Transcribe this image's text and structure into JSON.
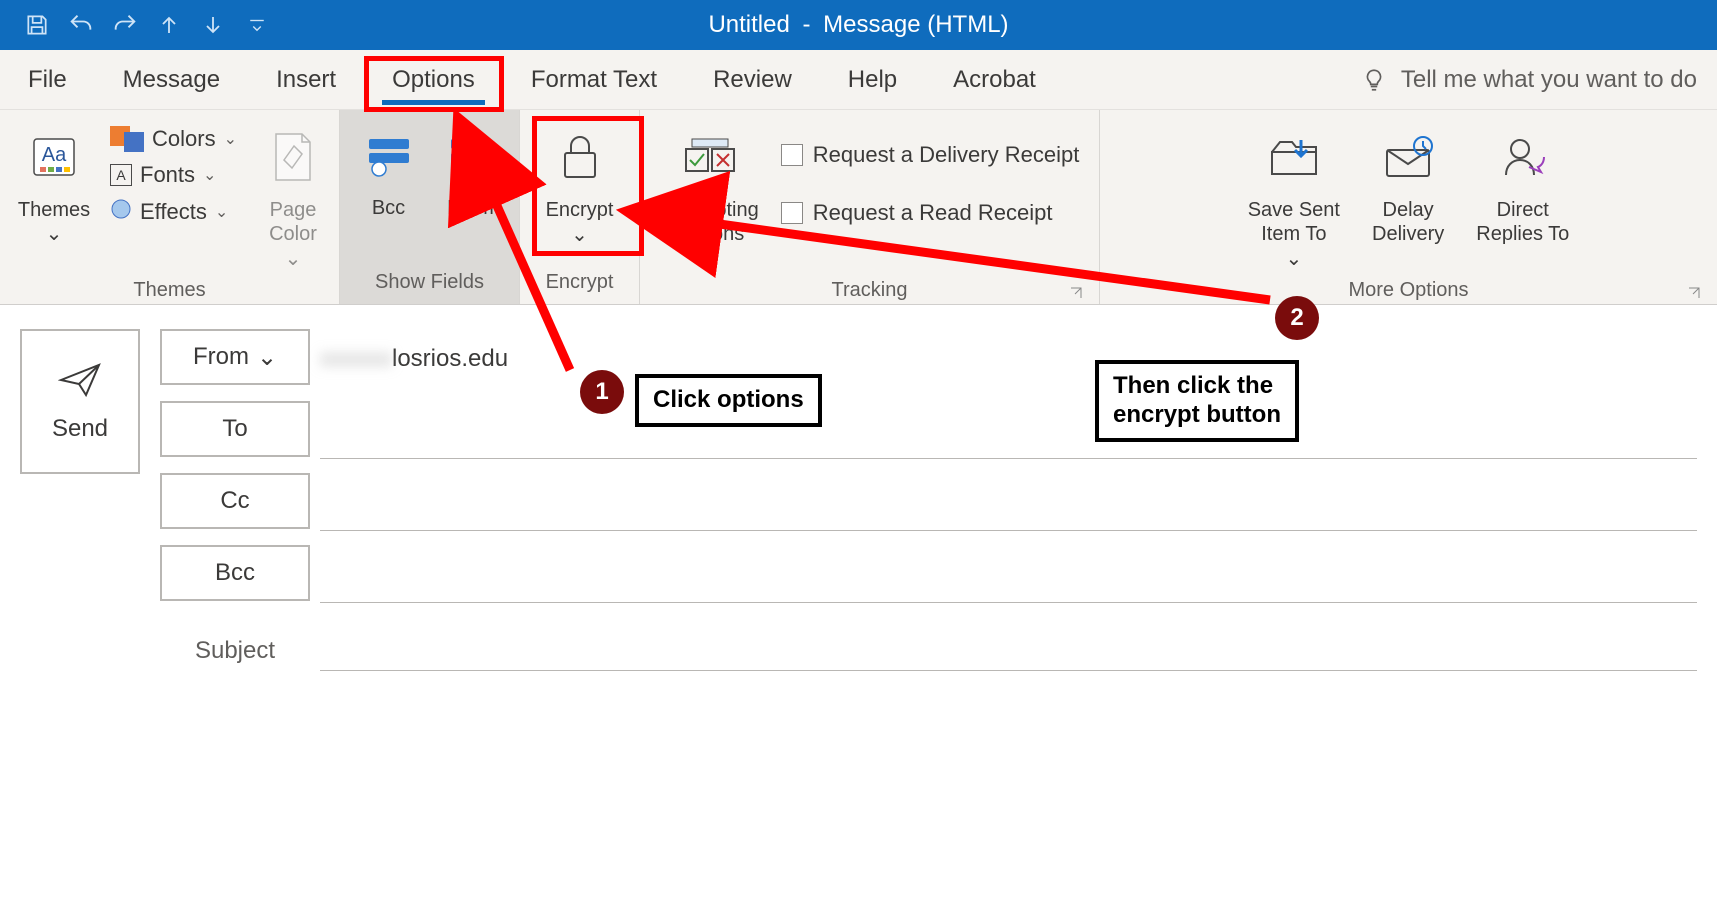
{
  "window": {
    "title": "Untitled",
    "subtitle": "Message (HTML)"
  },
  "tabs": {
    "file": "File",
    "message": "Message",
    "insert": "Insert",
    "options": "Options",
    "format_text": "Format Text",
    "review": "Review",
    "help": "Help",
    "acrobat": "Acrobat"
  },
  "tellme": {
    "placeholder": "Tell me what you want to do"
  },
  "ribbon": {
    "themes": {
      "label": "Themes",
      "themes_btn": "Themes",
      "colors": "Colors",
      "fonts": "Fonts",
      "effects": "Effects",
      "page_color": "Page\nColor"
    },
    "show_fields": {
      "label": "Show Fields",
      "bcc": "Bcc",
      "from": "From"
    },
    "encrypt_group": {
      "label": "Encrypt",
      "encrypt": "Encrypt"
    },
    "tracking": {
      "label": "Tracking",
      "voting": "Use Voting\nButtons",
      "delivery_receipt": "Request a Delivery Receipt",
      "read_receipt": "Request a Read Receipt"
    },
    "more_options": {
      "label": "More Options",
      "save_sent": "Save Sent\nItem To",
      "delay": "Delay\nDelivery",
      "direct": "Direct\nReplies To"
    }
  },
  "compose": {
    "send": "Send",
    "from_btn": "From",
    "to_btn": "To",
    "cc_btn": "Cc",
    "bcc_btn": "Bcc",
    "subject_label": "Subject",
    "from_value_hidden": "xxxxxx",
    "from_value_visible": "losrios.edu"
  },
  "annotations": {
    "step1_num": "1",
    "step1_text": "Click options",
    "step2_num": "2",
    "step2_text": "Then click the\nencrypt button"
  }
}
